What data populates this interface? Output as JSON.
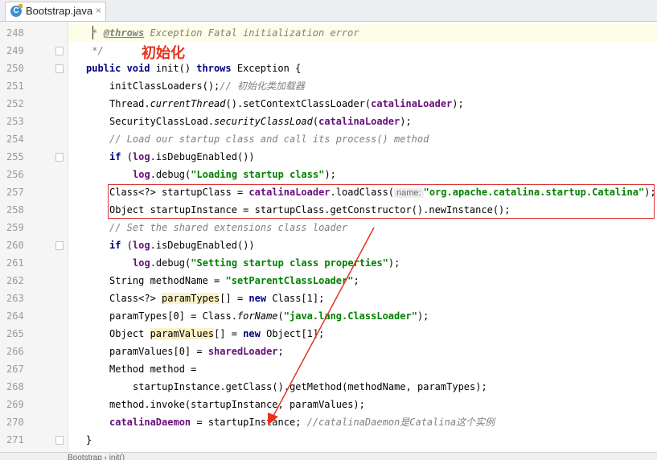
{
  "tab": {
    "icon": "java-class-icon",
    "filename": "Bootstrap.java",
    "close": "×"
  },
  "annotation": "初始化",
  "lines": [
    {
      "num": "248",
      "indent": 1,
      "segs": [
        [
          "doc",
          " * "
        ],
        [
          "tag",
          "@throws"
        ],
        [
          "doc",
          " Exception Fatal initialization error"
        ]
      ]
    },
    {
      "num": "249",
      "indent": 1,
      "segs": [
        [
          "doc",
          " */"
        ]
      ]
    },
    {
      "num": "250",
      "indent": 1,
      "segs": [
        [
          "kw",
          "public void "
        ],
        [
          "",
          "init() "
        ],
        [
          "kw",
          "throws "
        ],
        [
          "",
          "Exception {"
        ]
      ]
    },
    {
      "num": "251",
      "indent": 2,
      "segs": [
        [
          "",
          "initClassLoaders();"
        ],
        [
          "cm",
          "// 初始化类加载器"
        ]
      ]
    },
    {
      "num": "252",
      "indent": 2,
      "segs": [
        [
          "",
          "Thread."
        ],
        [
          "st",
          "currentThread"
        ],
        [
          "",
          "().setContextClassLoader("
        ],
        [
          "fld",
          "catalinaLoader"
        ],
        [
          "",
          ");"
        ]
      ]
    },
    {
      "num": "253",
      "indent": 2,
      "segs": [
        [
          "",
          "SecurityClassLoad."
        ],
        [
          "st",
          "securityClassLoad"
        ],
        [
          "",
          "("
        ],
        [
          "fld",
          "catalinaLoader"
        ],
        [
          "",
          ");"
        ]
      ]
    },
    {
      "num": "254",
      "indent": 2,
      "segs": [
        [
          "cm",
          "// Load our startup class and call its process() method"
        ]
      ]
    },
    {
      "num": "255",
      "indent": 2,
      "segs": [
        [
          "kw",
          "if "
        ],
        [
          "",
          "("
        ],
        [
          "fld",
          "log"
        ],
        [
          "",
          ".isDebugEnabled())"
        ]
      ]
    },
    {
      "num": "256",
      "indent": 3,
      "segs": [
        [
          "fld",
          "log"
        ],
        [
          "",
          ".debug("
        ],
        [
          "str",
          "\"Loading startup class\""
        ],
        [
          "",
          ");"
        ]
      ]
    },
    {
      "num": "257",
      "indent": 2,
      "segs": [
        [
          "",
          "Class<?> startupClass = "
        ],
        [
          "fld",
          "catalinaLoader"
        ],
        [
          "",
          ".loadClass("
        ],
        [
          "hint",
          "name:"
        ],
        [
          "str",
          "\"org.apache.catalina.startup.Catalina\""
        ],
        [
          "",
          ");"
        ]
      ]
    },
    {
      "num": "258",
      "indent": 2,
      "segs": [
        [
          "",
          "Object startupInstance = startupClass.getConstructor().newInstance();"
        ]
      ]
    },
    {
      "num": "259",
      "indent": 2,
      "segs": [
        [
          "cm",
          "// Set the shared extensions class loader"
        ]
      ]
    },
    {
      "num": "260",
      "indent": 2,
      "segs": [
        [
          "kw",
          "if "
        ],
        [
          "",
          "("
        ],
        [
          "fld",
          "log"
        ],
        [
          "",
          ".isDebugEnabled())"
        ]
      ]
    },
    {
      "num": "261",
      "indent": 3,
      "segs": [
        [
          "fld",
          "log"
        ],
        [
          "",
          ".debug("
        ],
        [
          "str",
          "\"Setting startup class properties\""
        ],
        [
          "",
          ");"
        ]
      ]
    },
    {
      "num": "262",
      "indent": 2,
      "segs": [
        [
          "",
          "String methodName = "
        ],
        [
          "str",
          "\"setParentClassLoader\""
        ],
        [
          "",
          ";"
        ]
      ]
    },
    {
      "num": "263",
      "indent": 2,
      "segs": [
        [
          "",
          "Class<?> "
        ],
        [
          "hl",
          "paramTypes"
        ],
        [
          "",
          "[] = "
        ],
        [
          "kw",
          "new "
        ],
        [
          "",
          "Class[1];"
        ]
      ]
    },
    {
      "num": "264",
      "indent": 2,
      "segs": [
        [
          "",
          "paramTypes[0] = Class."
        ],
        [
          "st",
          "forName"
        ],
        [
          "",
          "("
        ],
        [
          "str",
          "\"java.lang.ClassLoader\""
        ],
        [
          "",
          ");"
        ]
      ]
    },
    {
      "num": "265",
      "indent": 2,
      "segs": [
        [
          "",
          "Object "
        ],
        [
          "hl",
          "paramValues"
        ],
        [
          "",
          "[] = "
        ],
        [
          "kw",
          "new "
        ],
        [
          "",
          "Object[1];"
        ]
      ]
    },
    {
      "num": "266",
      "indent": 2,
      "segs": [
        [
          "",
          "paramValues[0] = "
        ],
        [
          "fld",
          "sharedLoader"
        ],
        [
          "",
          ";"
        ]
      ]
    },
    {
      "num": "267",
      "indent": 2,
      "segs": [
        [
          "",
          "Method method ="
        ]
      ]
    },
    {
      "num": "268",
      "indent": 3,
      "segs": [
        [
          "",
          "startupInstance.getClass().getMethod(methodName, paramTypes);"
        ]
      ]
    },
    {
      "num": "269",
      "indent": 2,
      "segs": [
        [
          "",
          "method.invoke(startupInstance, paramValues);"
        ]
      ]
    },
    {
      "num": "270",
      "indent": 2,
      "segs": [
        [
          "fld",
          "catalinaDaemon"
        ],
        [
          "",
          " = startupInstance; "
        ],
        [
          "cm",
          "//catalinaDaemon是Catalina这个实例"
        ]
      ]
    },
    {
      "num": "271",
      "indent": 1,
      "segs": [
        [
          "",
          "}"
        ]
      ]
    }
  ],
  "folds": [
    "249",
    "250",
    "255",
    "260",
    "271"
  ],
  "breadcrumb": "Bootstrap  ›  init()",
  "colors": {
    "annotation": "#e8321e",
    "box": "#dd3333",
    "arrow": "#e8321e"
  }
}
